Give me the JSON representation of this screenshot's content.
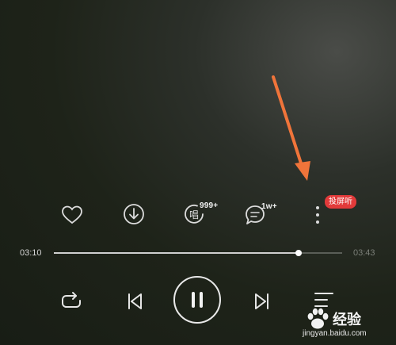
{
  "actions": {
    "sing_count": "999+",
    "comment_count": "1w+",
    "cast_label": "投屏听"
  },
  "progress": {
    "current_time": "03:10",
    "total_time": "03:43",
    "fraction": 0.85
  },
  "icons": [
    "heart-icon",
    "download-icon",
    "sing-icon",
    "comment-icon",
    "more-icon",
    "repeat-icon",
    "previous-icon",
    "pause-icon",
    "next-icon",
    "playlist-icon"
  ],
  "colors": {
    "accent_red": "#e23a3a",
    "annotation_arrow": "#f0743a",
    "progress_fill": "#cfcfcf"
  },
  "watermark": {
    "brand": "经验",
    "url": "jingyan.baidu.com"
  }
}
